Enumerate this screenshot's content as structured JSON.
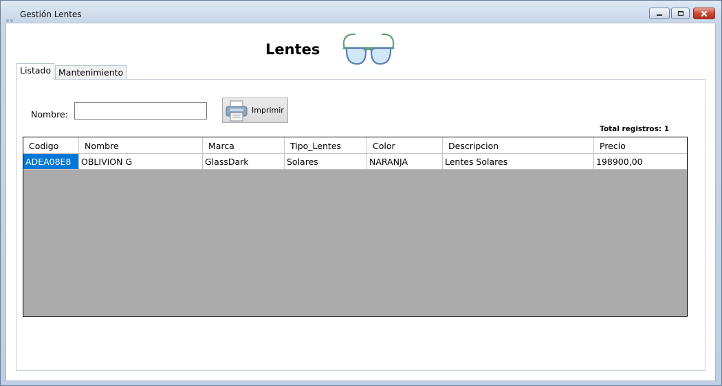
{
  "window": {
    "title": "Gestión Lentes"
  },
  "header": {
    "title": "Lentes",
    "logo_icon": "glasses-icon"
  },
  "tabs": [
    {
      "label": "Listado",
      "active": true
    },
    {
      "label": "Mantenimiento",
      "active": false
    }
  ],
  "filter": {
    "name_label": "Nombre:",
    "name_value": "",
    "print_label": "Imprimir",
    "print_icon": "printer-icon"
  },
  "total_label": "Total registros: 1",
  "grid": {
    "columns": [
      "Codigo",
      "Nombre",
      "Marca",
      "Tipo_Lentes",
      "Color",
      "Descripcion",
      "Precio"
    ],
    "rows": [
      [
        "ADEA08E8",
        "OBLIVION G",
        "GlassDark",
        "Solares",
        "NARANJA",
        "Lentes Solares",
        "198900,00"
      ]
    ]
  },
  "colors": {
    "selection": "#0078d7",
    "grid_background": "#ababab",
    "close_button": "#c9442f"
  }
}
